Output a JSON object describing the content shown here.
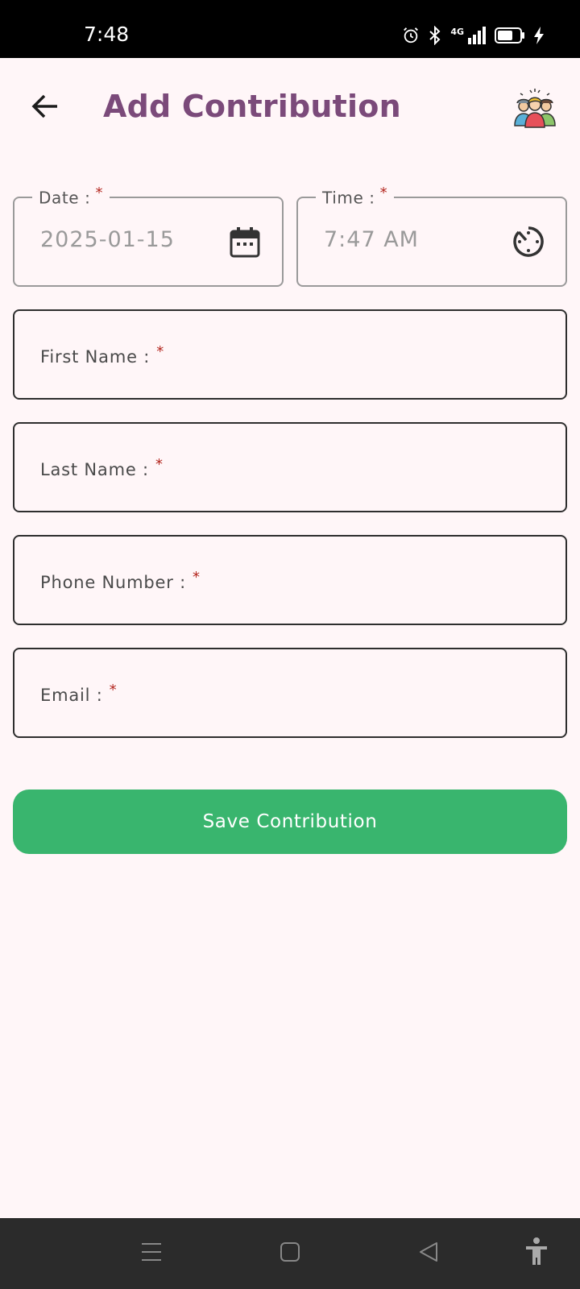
{
  "status_bar": {
    "time": "7:48",
    "network": "4G",
    "icons": [
      "alarm-icon",
      "bluetooth-icon",
      "signal-icon",
      "battery-icon",
      "charging-icon"
    ]
  },
  "app_bar": {
    "title": "Add Contribution",
    "back_icon": "arrow-left-icon",
    "logo_icon": "team-icon"
  },
  "form": {
    "date": {
      "label": "Date :",
      "required_mark": "*",
      "value": "2025-01-15",
      "icon": "calendar-icon"
    },
    "time": {
      "label": "Time :",
      "required_mark": "*",
      "value": "7:47 AM",
      "icon": "clock-icon"
    },
    "first_name": {
      "label": "First Name :",
      "required_mark": "*"
    },
    "last_name": {
      "label": "Last Name :",
      "required_mark": "*"
    },
    "phone": {
      "label": "Phone Number :",
      "required_mark": "*"
    },
    "email": {
      "label": "Email :",
      "required_mark": "*"
    }
  },
  "save_button": {
    "label": "Save Contribution"
  },
  "colors": {
    "title": "#7b4a7a",
    "primary_button": "#39b56e",
    "background": "#fff6f8",
    "required": "#b3261e"
  },
  "nav_bar": {
    "icons": [
      "menu-icon",
      "home-icon",
      "back-icon",
      "accessibility-icon"
    ]
  }
}
